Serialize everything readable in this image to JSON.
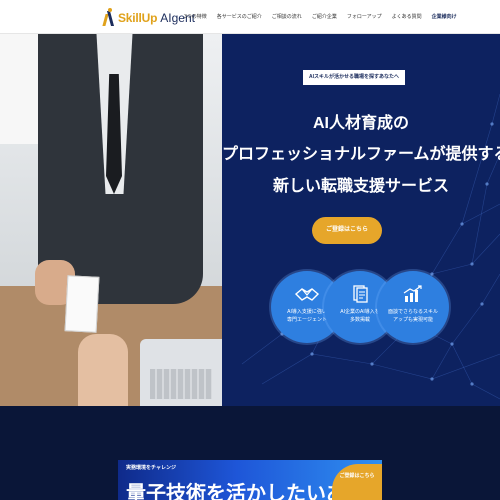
{
  "header": {
    "logo_main": "SkillUp",
    "logo_sub": "AIgent",
    "nav": [
      "3つの特徴",
      "各サービスのご紹介",
      "ご相談の流れ",
      "ご紹介企業",
      "フォローアップ",
      "よくある質問",
      "企業様向け"
    ]
  },
  "hero": {
    "badge": "AIスキルが活かせる職場を探すあなたへ",
    "title_line1": "AI人材育成の",
    "title_line2": "プロフェッショナルファームが提供する",
    "title_line3": "新しい転職支援サービス",
    "cta_label": "ご登録はこちら",
    "features": [
      {
        "label": "AI導入支援に強い\n専門エージェント",
        "icon": "handshake-icon"
      },
      {
        "label": "AI企業のAI導入を\n多数掲載",
        "icon": "documents-icon"
      },
      {
        "label": "面談でさらなるスキル\nアップも実現可能",
        "icon": "growth-chart-icon"
      }
    ]
  },
  "banner": {
    "tag": "実務環境をチャレンジ",
    "headline": "量子技術を活かしたいあなたへ",
    "button": "ご登録はこちら"
  },
  "colors": {
    "navy": "#0d2260",
    "accent": "#e6a62a",
    "feature_blue": "#2e7fe0"
  }
}
